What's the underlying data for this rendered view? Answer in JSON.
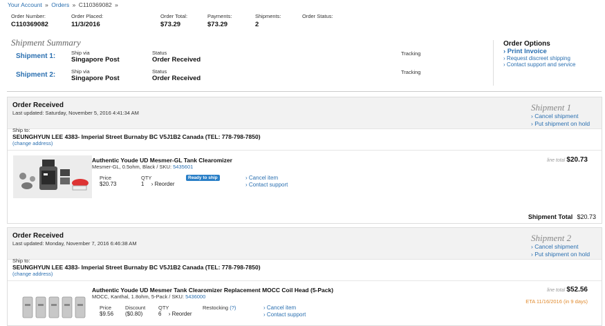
{
  "breadcrumb": {
    "account": "Your Account",
    "orders": "Orders",
    "current": "C110369082",
    "sep": "»"
  },
  "summary": {
    "order_number": {
      "label": "Order Number:",
      "value": "C110369082"
    },
    "order_placed": {
      "label": "Order Placed:",
      "value": "11/3/2016"
    },
    "order_total": {
      "label": "Order Total:",
      "value": "$73.29"
    },
    "payments": {
      "label": "Payments:",
      "value": "$73.29"
    },
    "shipments": {
      "label": "Shipments:",
      "value": "2"
    },
    "order_status": {
      "label": "Order Status:",
      "value": ""
    }
  },
  "shipment_summary": {
    "title": "Shipment Summary",
    "rows": [
      {
        "name": "Shipment 1:",
        "ship_via_label": "Ship via",
        "ship_via": "Singapore Post",
        "status_label": "Status",
        "status": "Order Received",
        "tracking_label": "Tracking"
      },
      {
        "name": "Shipment 2:",
        "ship_via_label": "Ship via",
        "ship_via": "Singapore Post",
        "status_label": "Status",
        "status": "Order Received",
        "tracking_label": "Tracking"
      }
    ]
  },
  "order_options": {
    "title": "Order Options",
    "print_invoice": "› Print Invoice",
    "discreet": "› Request discreet shipping",
    "contact": "› Contact support and service"
  },
  "shipments": [
    {
      "status": "Order Received",
      "updated": "Last updated: Saturday, November 5, 2016 4:41:34 AM",
      "tag": "Shipment 1",
      "cancel": "› Cancel shipment",
      "hold": "› Put shipment on hold",
      "ship_to_label": "Ship to:",
      "ship_to": "SEUNGHYUN LEE 4383- Imperial Street Burnaby BC V5J1B2 Canada (TEL: 778-798-7850)",
      "change": "(change address)",
      "item": {
        "name": "Authentic Youde UD Mesmer-GL Tank Clearomizer",
        "sub_prefix": "Mesmer-GL, 0.5ohm, Black / SKU: ",
        "sku": "5435601",
        "price_label": "Price",
        "price": "$20.73",
        "qty_label": "QTY",
        "qty": "1",
        "reorder": "› Reorder",
        "badge": "Ready to ship",
        "cancel_item": "› Cancel item",
        "contact": "› Contact support",
        "line_total_label": "line total",
        "line_total": "$20.73"
      },
      "total_label": "Shipment Total",
      "total": "$20.73"
    },
    {
      "status": "Order Received",
      "updated": "Last updated: Monday, November 7, 2016 6:46:38 AM",
      "tag": "Shipment 2",
      "cancel": "› Cancel shipment",
      "hold": "› Put shipment on hold",
      "ship_to_label": "Ship to:",
      "ship_to": "SEUNGHYUN LEE 4383- Imperial Street Burnaby BC V5J1B2 Canada (TEL: 778-798-7850)",
      "change": "(change address)",
      "item": {
        "name": "Authentic Youde UD Mesmer Tank Clearomizer Replacement MOCC Coil Head (5-Pack)",
        "sub_prefix": "MOCC, Kanthal, 1.8ohm, 5-Pack / SKU: ",
        "sku": "5436000",
        "price_label": "Price",
        "price": "$9.56",
        "discount_label": "Discount",
        "discount": "($0.80)",
        "qty_label": "QTY",
        "qty": "6",
        "reorder": "› Reorder",
        "restocking_label": "Restocking",
        "restocking_q": "(?)",
        "cancel_item": "› Cancel item",
        "contact": "› Contact support",
        "line_total_label": "line total",
        "line_total": "$52.56",
        "eta": "ETA 11/16/2016 (in 9 days)"
      }
    }
  ]
}
